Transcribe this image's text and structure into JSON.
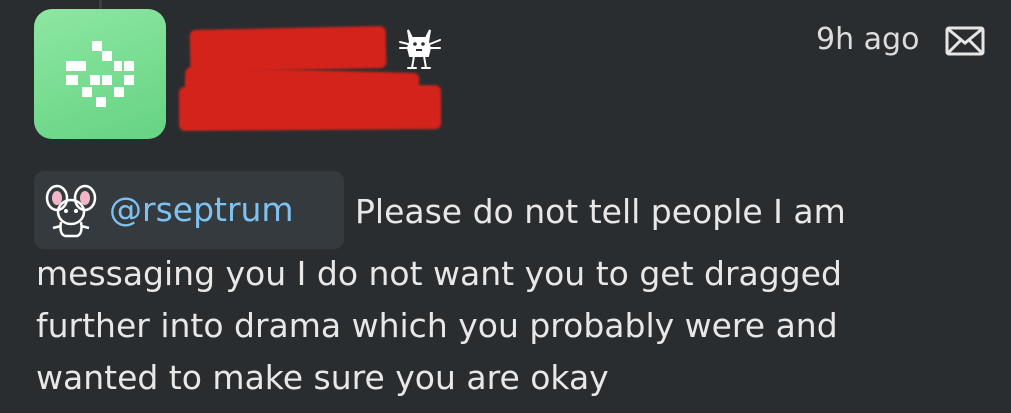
{
  "post": {
    "timestamp": "9h ago",
    "mention": {
      "handle": "@rseptrum"
    },
    "message_lines": [
      "Please do not tell people I am",
      "messaging you I do not want you to get dragged",
      "further into drama which you probably were and",
      "wanted to make sure you are okay"
    ]
  },
  "icons": {
    "avatar": "pixel-identicon",
    "badge": "cat-icon",
    "dm": "envelope-icon",
    "mention_avatar": "bunny-icon"
  },
  "colors": {
    "background": "#2a2d2f",
    "mention_bg": "#353a3f",
    "mention_text": "#7ec2ef",
    "avatar_green": "#7ddf95",
    "redaction": "#d3231b"
  }
}
